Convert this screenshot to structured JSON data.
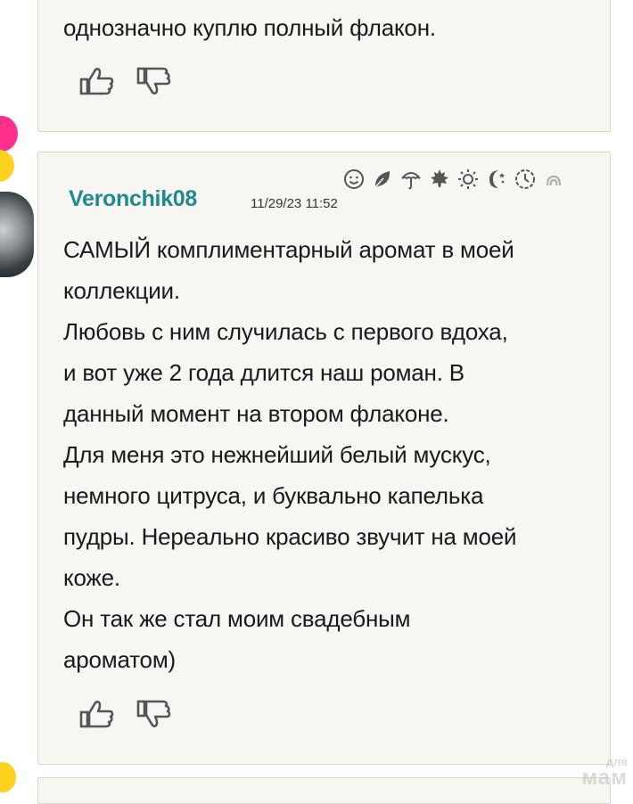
{
  "previous_comment": {
    "text_tail": "однозначно куплю полный флакон."
  },
  "comment": {
    "username": "Veronchik08",
    "timestamp": "11/29/23 11:52",
    "lines": [
      "САМЫЙ комплиментарный аромат в моей",
      "коллекции.",
      "Любовь с ним случилась с первого вдоха,",
      "и вот уже 2 года длится наш роман. В",
      "данный момент на втором флаконе.",
      "Для меня это нежнейший белый мускус,",
      "немного цитруса, и буквально капелька",
      "пудры. Нереально красиво звучит на моей",
      "коже.",
      "Он так же стал моим свадебным",
      "ароматом)"
    ],
    "status_icons": [
      "smiley-icon",
      "leaf-icon",
      "umbrella-icon",
      "maple-leaf-icon",
      "sun-icon",
      "moon-stars-icon",
      "clock-icon",
      "rainbow-icon"
    ]
  },
  "watermark": {
    "line1": "для",
    "line2": "мам"
  },
  "colors": {
    "username": "#1f8a8f",
    "card_bg": "#f8f6f3",
    "card_border": "#d9d5cf",
    "icon": "#555555"
  }
}
